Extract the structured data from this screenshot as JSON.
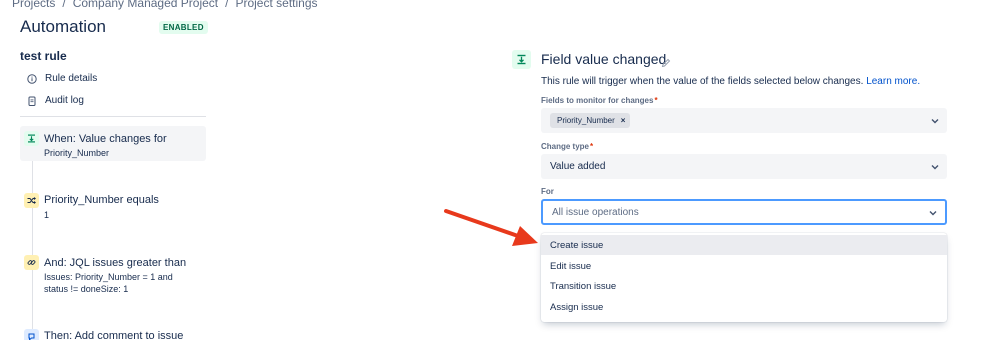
{
  "breadcrumb": {
    "items": [
      "Projects",
      "Company Managed Project",
      "Project settings"
    ],
    "separator": "/"
  },
  "header": {
    "title": "Automation",
    "status_badge": "ENABLED"
  },
  "sidebar": {
    "rule_name": "test rule",
    "links": [
      {
        "label": "Rule details",
        "icon": "info-icon"
      },
      {
        "label": "Audit log",
        "icon": "clipboard-icon"
      }
    ],
    "steps": [
      {
        "title": "When: Value changes for",
        "lines": [
          "Priority_Number"
        ],
        "icon": "trigger-icon",
        "selected": true
      },
      {
        "title": "Priority_Number equals",
        "lines": [
          "1"
        ],
        "icon": "condition-icon",
        "selected": false
      },
      {
        "title": "And: JQL issues greater than",
        "lines": [
          "Issues: Priority_Number = 1 and",
          "status != doneSize: 1"
        ],
        "icon": "link-icon",
        "selected": false
      },
      {
        "title": "Then: Add comment to issue",
        "lines": [],
        "icon": "action-icon",
        "selected": false
      }
    ]
  },
  "panel": {
    "title": "Field value changed",
    "description": "This rule will trigger when the value of the fields selected below changes.",
    "learn_more": "Learn more.",
    "fields_label": "Fields to monitor for changes",
    "fields_selected": [
      "Priority_Number"
    ],
    "change_type_label": "Change type",
    "change_type_value": "Value added",
    "for_label": "For",
    "for_placeholder": "All issue operations",
    "for_options": [
      "Create issue",
      "Edit issue",
      "Transition issue",
      "Assign issue"
    ],
    "hovered_option": "Create issue"
  },
  "colors": {
    "accent_blue": "#0052cc",
    "focus_border": "#4c9aff",
    "annotation_arrow": "#e8391c",
    "badge_green_bg": "#e3fcef",
    "badge_green_text": "#006644"
  }
}
